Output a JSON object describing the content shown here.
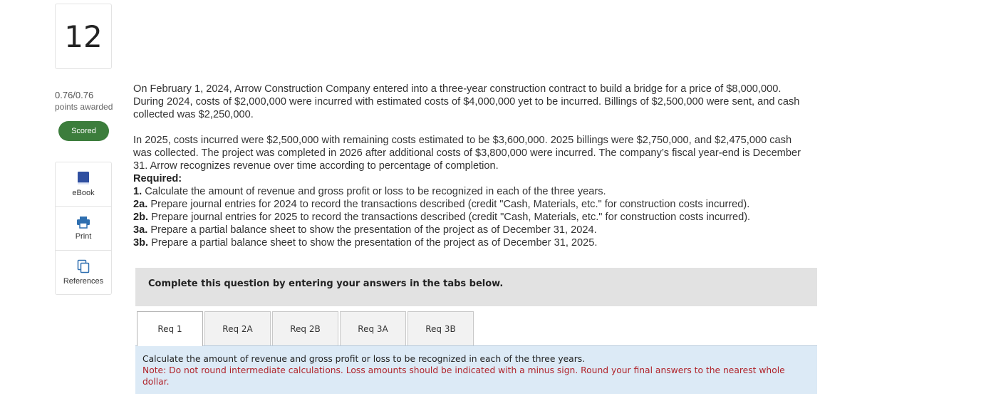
{
  "question": {
    "number": "12",
    "score": "0.76/0.76",
    "points_awarded_label": "points awarded",
    "status": "Scored"
  },
  "tools": {
    "ebook": "eBook",
    "print": "Print",
    "references": "References"
  },
  "body": {
    "para1": "On February 1, 2024, Arrow Construction Company entered into a three-year construction contract to build a bridge for a price of $8,000,000. During 2024, costs of $2,000,000 were incurred with estimated costs of $4,000,000 yet to be incurred. Billings of $2,500,000 were sent, and cash collected was $2,250,000.",
    "para2": "In 2025, costs incurred were $2,500,000 with remaining costs estimated to be $3,600,000. 2025 billings were $2,750,000, and $2,475,000 cash was collected. The project was completed in 2026 after additional costs of $3,800,000 were incurred. The company’s fiscal year-end is December 31. Arrow recognizes revenue over time according to percentage of completion.",
    "required_label": "Required:",
    "requirements": [
      {
        "num": "1.",
        "text": " Calculate the amount of revenue and gross profit or loss to be recognized in each of the three years."
      },
      {
        "num": "2a.",
        "text": " Prepare journal entries for 2024 to record the transactions described (credit \"Cash, Materials, etc.\" for construction costs incurred)."
      },
      {
        "num": "2b.",
        "text": " Prepare journal entries for 2025 to record the transactions described (credit \"Cash, Materials, etc.\" for construction costs incurred)."
      },
      {
        "num": "3a.",
        "text": " Prepare a partial balance sheet to show the presentation of the project as of December 31, 2024."
      },
      {
        "num": "3b.",
        "text": " Prepare a partial balance sheet to show the presentation of the project as of December 31, 2025."
      }
    ]
  },
  "panel": {
    "instruction": "Complete this question by entering your answers in the tabs below."
  },
  "tabs": [
    "Req 1",
    "Req 2A",
    "Req 2B",
    "Req 3A",
    "Req 3B"
  ],
  "active_tab": "Req 1",
  "req1": {
    "instruction": "Calculate the amount of revenue and gross profit or loss to be recognized in each of the three years.",
    "note": "Note: Do not round intermediate calculations. Loss amounts should be indicated with a minus sign. Round your final answers to the nearest whole dollar."
  },
  "colors": {
    "scored_badge": "#3c7d3c",
    "ebook_icon": "#2f4fa0",
    "print_icon": "#2f6fb0",
    "note_text": "#b0232a",
    "tab_content_bg": "#dceaf6"
  }
}
